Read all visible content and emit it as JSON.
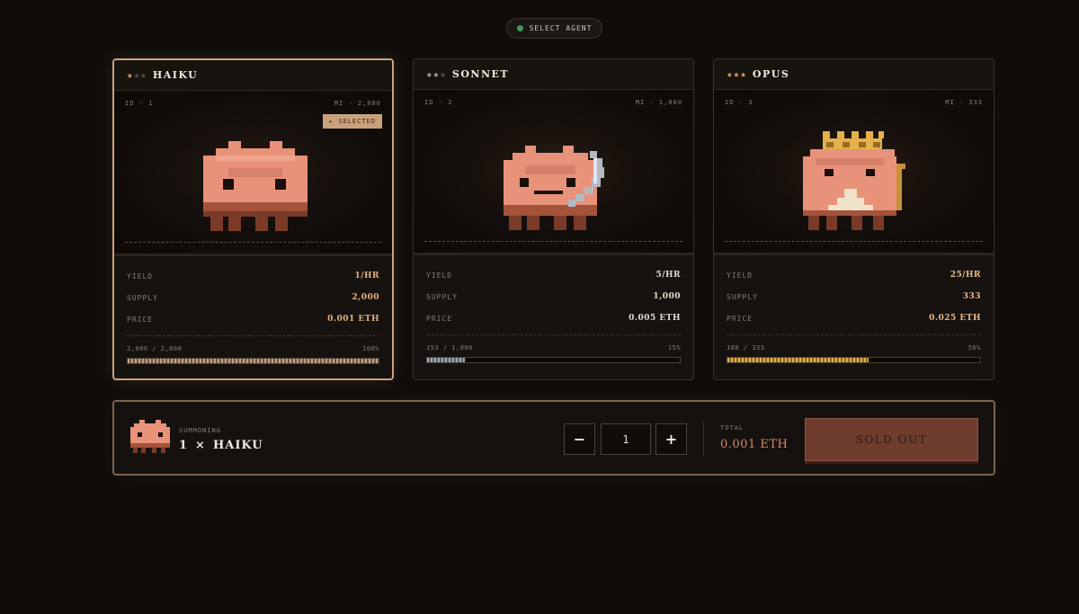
{
  "header": {
    "pill_label": "SELECT AGENT"
  },
  "colors": {
    "accent": "#c9a27c",
    "status_dot": "#3f9a5a",
    "creature": "#e8927a",
    "sold_out": "#6e3d2e"
  },
  "cards": [
    {
      "title": "HAIKU",
      "stars_filled": 1,
      "stars_total": 3,
      "star_color": "gold",
      "id": "ID · 1",
      "max": "MI · 2,000",
      "badge": "▸ SELECTED",
      "stats": [
        {
          "label": "YIELD",
          "value": "1/HR"
        },
        {
          "label": "SUPPLY",
          "value": "2,000"
        },
        {
          "label": "PRICE",
          "value": "0.001 ETH"
        }
      ],
      "progress_text": "2,000 / 2,000",
      "progress_pct": "100%",
      "progress": 1.0
    },
    {
      "title": "SONNET",
      "stars_filled": 2,
      "stars_total": 3,
      "star_color": "silver",
      "id": "ID · 2",
      "max": "MI · 1,000",
      "stats": [
        {
          "label": "YIELD",
          "value": "5/HR"
        },
        {
          "label": "SUPPLY",
          "value": "1,000"
        },
        {
          "label": "PRICE",
          "value": "0.005 ETH"
        }
      ],
      "progress_text": "153 / 1,000",
      "progress_pct": "15%",
      "progress": 0.15
    },
    {
      "title": "OPUS",
      "stars_filled": 3,
      "stars_total": 3,
      "star_color": "gold",
      "id": "ID · 3",
      "max": "MI · 333",
      "stats": [
        {
          "label": "YIELD",
          "value": "25/HR"
        },
        {
          "label": "SUPPLY",
          "value": "333"
        },
        {
          "label": "PRICE",
          "value": "0.025 ETH"
        }
      ],
      "progress_text": "188 / 333",
      "progress_pct": "56%",
      "progress": 0.56
    }
  ],
  "footer": {
    "summoning_label": "SUMMONING",
    "qty_prefix": "1",
    "times": "×",
    "agent": "HAIKU",
    "minus": "−",
    "plus": "+",
    "quantity": "1",
    "total_label": "TOTAL",
    "total_value": "0.001 ETH",
    "button": "SOLD OUT"
  }
}
